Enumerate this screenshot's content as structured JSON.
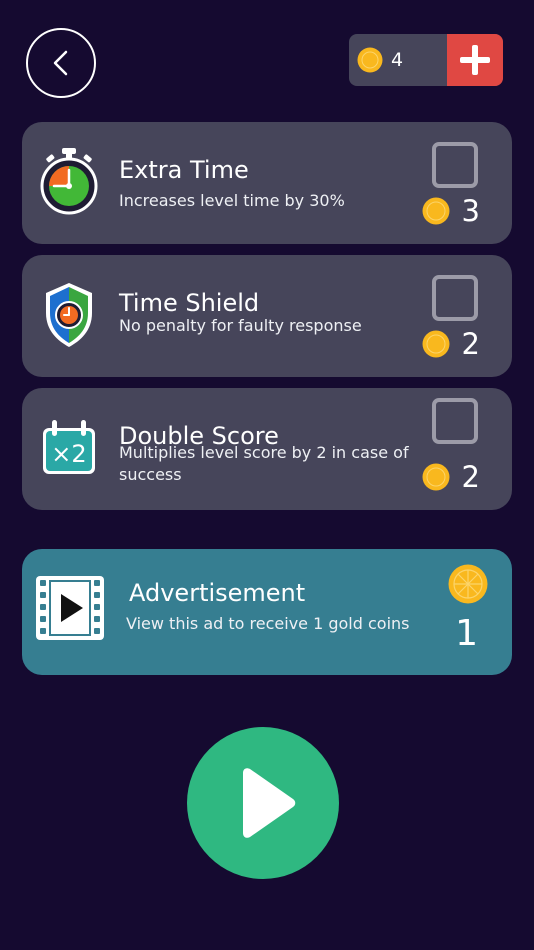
{
  "header": {
    "back_icon": "chevron-left-icon",
    "coins": "4",
    "add_icon": "plus-icon"
  },
  "colors": {
    "background": "#150a30",
    "card": "#46455a",
    "ad_card": "#367e91",
    "coin": "#f9b81e",
    "add_button": "#e04843",
    "play_button": "#2fb881",
    "checkbox_border": "#9c9ba8"
  },
  "powerups": [
    {
      "icon": "stopwatch-icon",
      "title": "Extra Time",
      "description": "Increases level time by 30%",
      "price": "3",
      "selected": false
    },
    {
      "icon": "shield-clock-icon",
      "title": "Time Shield",
      "description": "No penalty for faulty response",
      "price": "2",
      "selected": false
    },
    {
      "icon": "calendar-x2-icon",
      "title": "Double Score",
      "description": "Multiplies level score by 2 in case of success",
      "price": "2",
      "selected": false
    }
  ],
  "advertisement": {
    "icon": "film-play-icon",
    "title": "Advertisement",
    "description": "View this ad to receive 1 gold coins",
    "reward": "1"
  },
  "play": {
    "icon": "play-icon"
  }
}
